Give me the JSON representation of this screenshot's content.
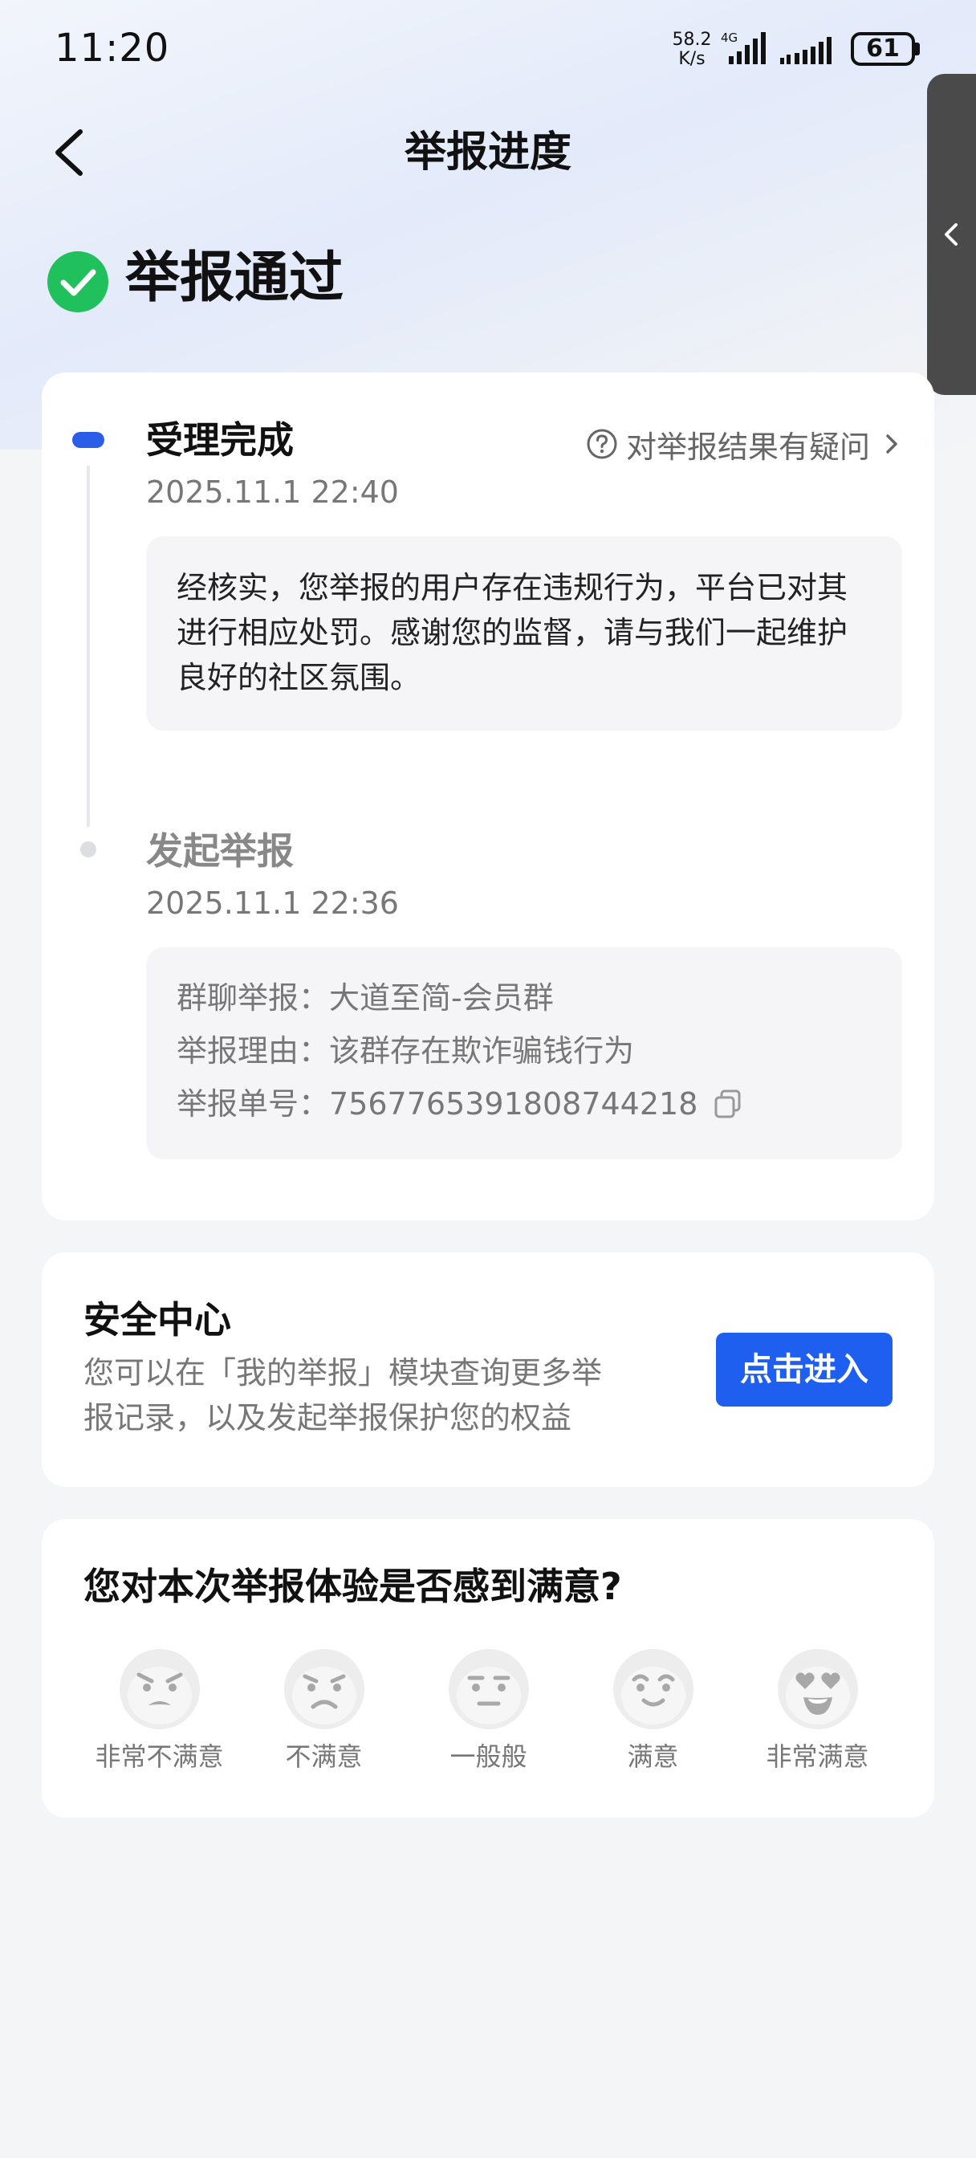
{
  "status_bar": {
    "time": "11:20",
    "net_speed_value": "58.2",
    "net_speed_unit": "K/s",
    "network_type": "4G",
    "battery": "61"
  },
  "header": {
    "title": "举报进度"
  },
  "result": {
    "status": "举报通过",
    "icon": "check-circle-icon",
    "accent_color": "#20c05c"
  },
  "timeline": {
    "question_link": "对举报结果有疑问",
    "steps": [
      {
        "title": "受理完成",
        "time": "2025.11.1 22:40",
        "lines": [
          "经核实，您举报的用户存在违规行为，平台已对其",
          "进行相应处罚。感谢您的监督，请与我们一起维护",
          "良好的社区氛围。"
        ]
      },
      {
        "title": "发起举报",
        "time": "2025.11.1 22:36",
        "details": [
          {
            "label": "群聊举报：",
            "value": "大道至简-会员群"
          },
          {
            "label": "举报理由：",
            "value": "该群存在欺诈骗钱行为"
          },
          {
            "label": "举报单号：",
            "value": "7567765391808744218"
          }
        ]
      }
    ]
  },
  "security": {
    "title": "安全中心",
    "desc_lines": [
      "您可以在「我的举报」模块查询更多举",
      "报记录，以及发起举报保护您的权益"
    ],
    "button": "点击进入",
    "button_color": "#1f5ff0"
  },
  "survey": {
    "title": "您对本次举报体验是否感到满意?",
    "options": [
      "非常不满意",
      "不满意",
      "一般般",
      "满意",
      "非常满意"
    ]
  }
}
